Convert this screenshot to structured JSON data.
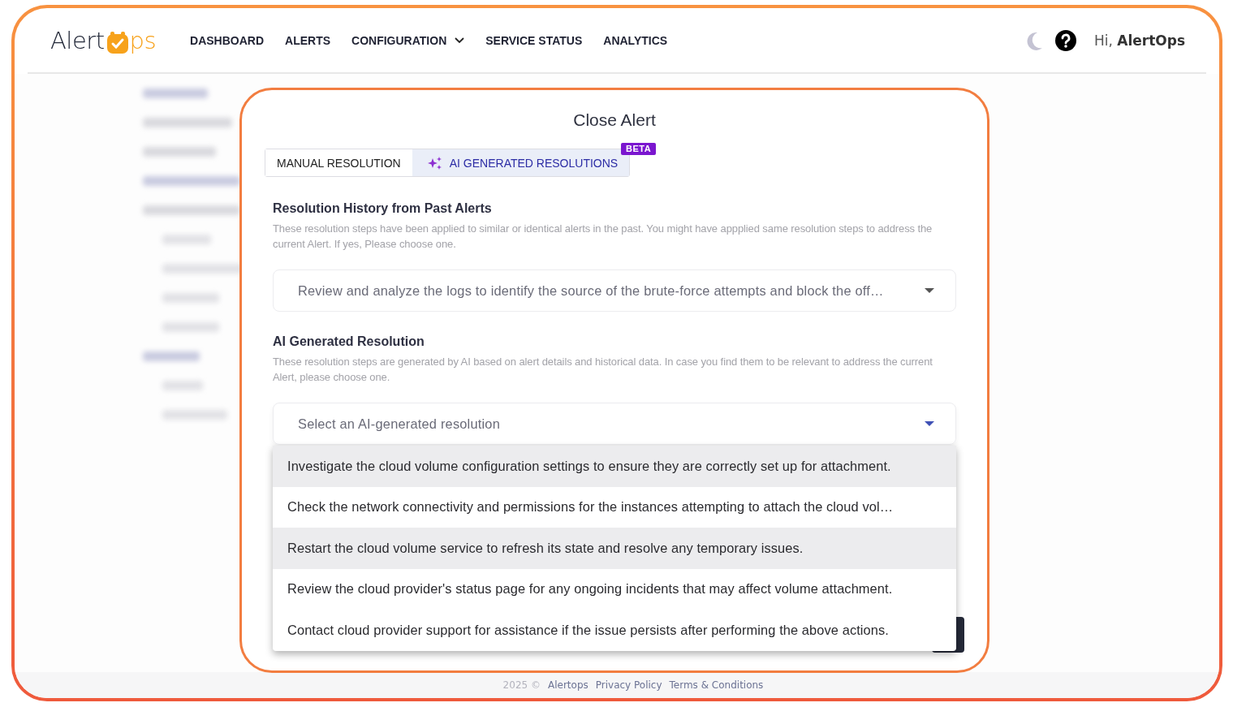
{
  "header": {
    "logo": {
      "left": "Alert",
      "right": "ps"
    },
    "nav": [
      {
        "label": "DASHBOARD",
        "dropdown": false
      },
      {
        "label": "ALERTS",
        "dropdown": false
      },
      {
        "label": "CONFIGURATION",
        "dropdown": true
      },
      {
        "label": "SERVICE STATUS",
        "dropdown": false
      },
      {
        "label": "ANALYTICS",
        "dropdown": false
      }
    ],
    "greeting": "Hi,",
    "user": "AlertOps"
  },
  "dialog": {
    "title": "Close Alert",
    "tabs": [
      {
        "label": "MANUAL RESOLUTION",
        "selected": false,
        "icon": false
      },
      {
        "label": "AI GENERATED RESOLUTIONS",
        "selected": true,
        "icon": true,
        "badge": "BETA"
      }
    ],
    "sections": [
      {
        "heading": "Resolution History from Past Alerts",
        "description": "These resolution steps have been applied to similar or identical alerts in the past. You might have appplied same resolution steps to address the current Alert. If yes, Please choose one.",
        "select": {
          "value": "Review and analyze the logs to identify the source of the brute-force attempts and block the off…"
        }
      },
      {
        "heading": "AI Generated Resolution",
        "description": "These resolution steps are generated by AI based on alert details and historical data. In case you find them to be relevant to address the current Alert, please choose one.",
        "select": {
          "placeholder": "Select an AI-generated resolution",
          "options": [
            {
              "label": "Investigate the cloud volume configuration settings to ensure they are correctly set up for attachment.",
              "highlighted": true
            },
            {
              "label": "Check the network connectivity and permissions for the instances attempting to attach the cloud vol…",
              "highlighted": false
            },
            {
              "label": "Restart the cloud volume service to refresh its state and resolve any temporary issues.",
              "highlighted": true
            },
            {
              "label": "Review the cloud provider's status page for any ongoing incidents that may affect volume attachment.",
              "highlighted": false
            },
            {
              "label": "Contact cloud provider support for assistance if the issue persists after performing the above actions.",
              "highlighted": false
            }
          ]
        }
      }
    ]
  },
  "footer": {
    "copyright": "2025 ©",
    "links": [
      "Alertops",
      "Privacy Policy",
      "Terms & Conditions"
    ]
  }
}
